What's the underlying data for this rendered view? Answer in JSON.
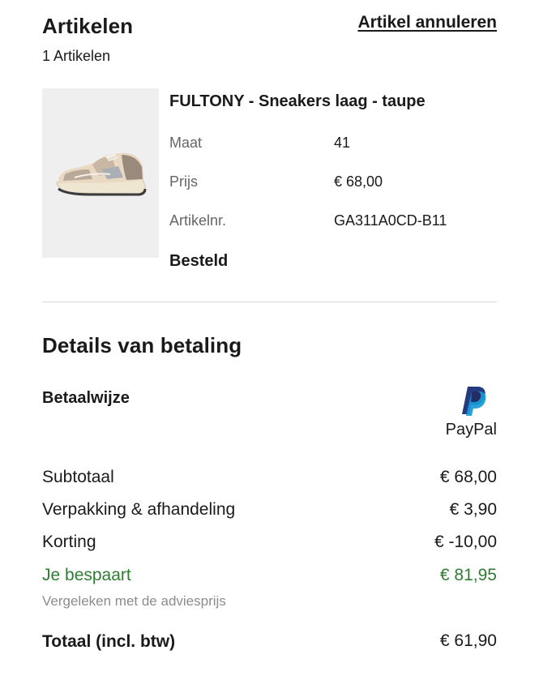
{
  "items": {
    "title": "Artikelen",
    "count": "1 Artikelen",
    "cancel_link": "Artikel annuleren"
  },
  "product": {
    "name": "FULTONY - Sneakers laag - taupe",
    "image_icon": "sneaker-image",
    "attributes": [
      {
        "label": "Maat",
        "value": "41"
      },
      {
        "label": "Prijs",
        "value": "€ 68,00"
      },
      {
        "label": "Artikelnr.",
        "value": "GA311A0CD-B11"
      }
    ],
    "status": "Besteld"
  },
  "payment": {
    "title": "Details van betaling",
    "method_label": "Betaalwijze",
    "method_name": "PayPal",
    "method_icon": "paypal-icon",
    "summary": [
      {
        "label": "Subtotaal",
        "value": "€ 68,00"
      },
      {
        "label": "Verpakking & afhandeling",
        "value": "€ 3,90"
      },
      {
        "label": "Korting",
        "value": "€ -10,00"
      }
    ],
    "savings": {
      "label": "Je bespaart",
      "value": "€ 81,95",
      "note": "Vergeleken met de adviesprijs"
    },
    "total": {
      "label": "Totaal (incl. btw)",
      "value": "€ 61,90"
    }
  },
  "colors": {
    "text": "#1a1a1a",
    "muted": "#666666",
    "savings_green": "#2e7d32",
    "paypal_dark_blue": "#253b80",
    "paypal_light_blue": "#179bd7",
    "image_background": "#efefef"
  }
}
